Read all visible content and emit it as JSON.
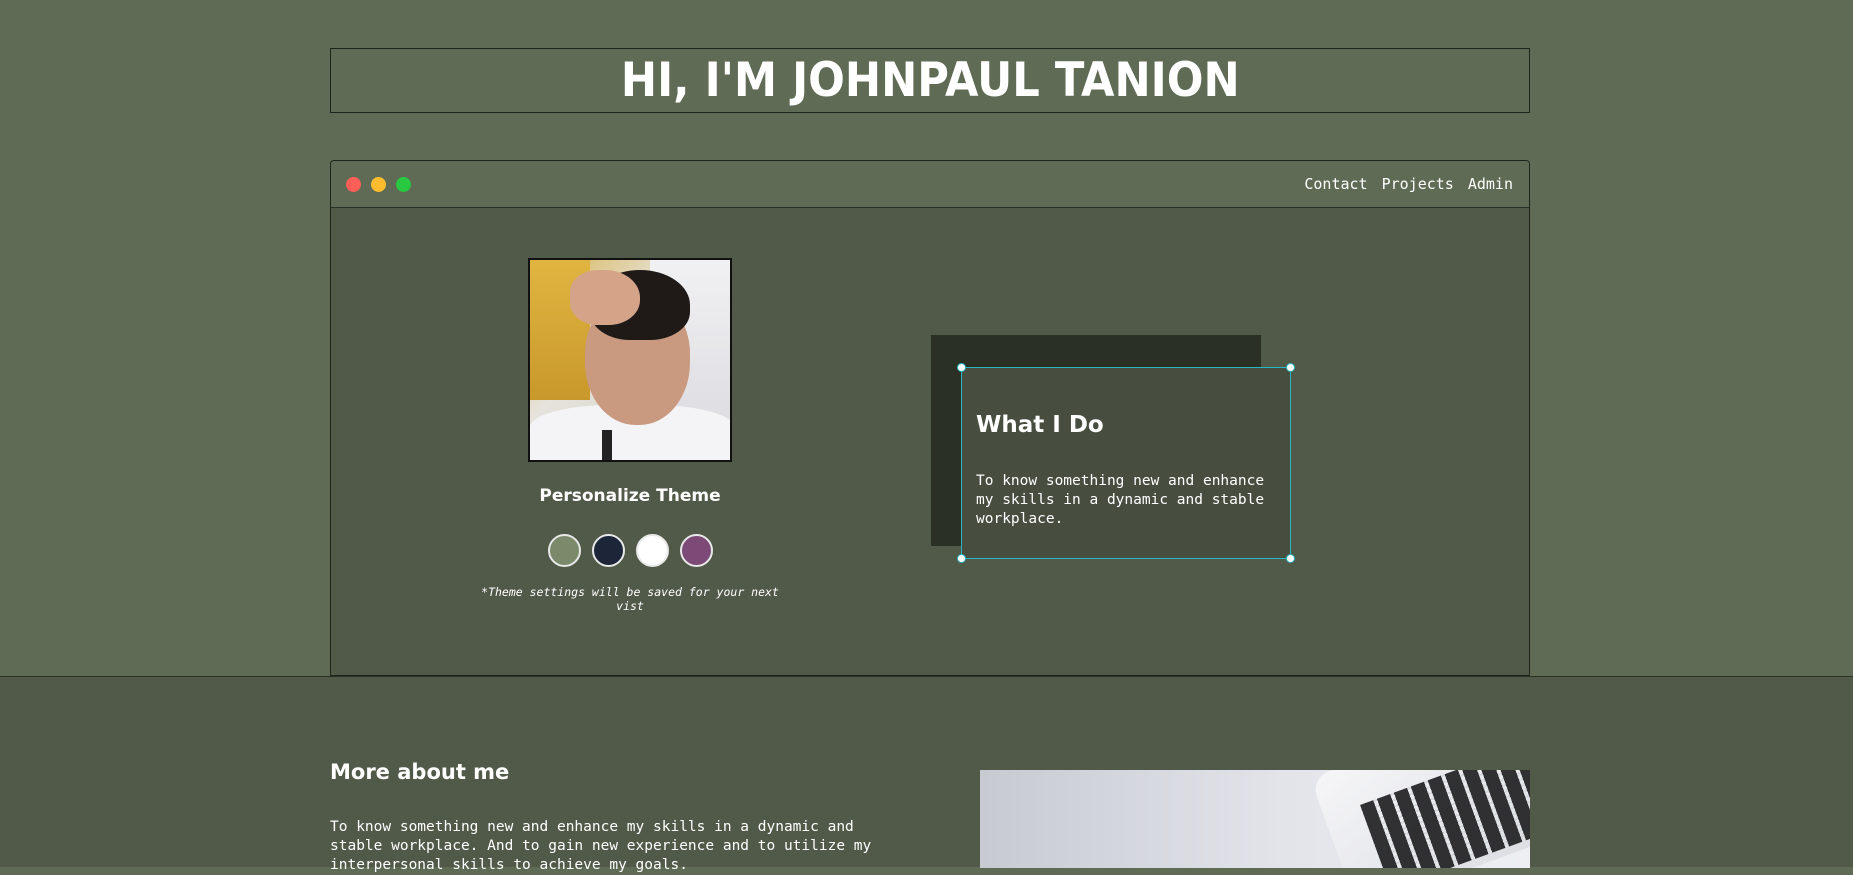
{
  "header": {
    "title": "HI, I'M JOHNPAUL TANION"
  },
  "window": {
    "nav": {
      "contact": "Contact",
      "projects": "Projects",
      "admin": "Admin"
    },
    "controls": [
      "close-icon",
      "minimize-icon",
      "maximize-icon"
    ],
    "control_colors": [
      "#ff5f57",
      "#febc2e",
      "#28c840"
    ]
  },
  "theme": {
    "title": "Personalize Theme",
    "swatches": [
      {
        "name": "sage",
        "color": "#7a8a6a"
      },
      {
        "name": "navy",
        "color": "#1c2638"
      },
      {
        "name": "white",
        "color": "#ffffff"
      },
      {
        "name": "plum",
        "color": "#7d4a78"
      }
    ],
    "note": "*Theme settings will be saved for your next vist"
  },
  "what_i_do": {
    "title": "What I Do",
    "text": "To know something new and enhance my skills in a dynamic and stable workplace."
  },
  "more_about": {
    "title": "More about me",
    "text": "To know something new and enhance my skills in a dynamic and stable workplace. And to gain new experience and to utilize my interpersonal skills to achieve my goals."
  },
  "colors": {
    "background": "#5f6b55",
    "panel": "#515a49",
    "selection": "#29b6c4"
  }
}
